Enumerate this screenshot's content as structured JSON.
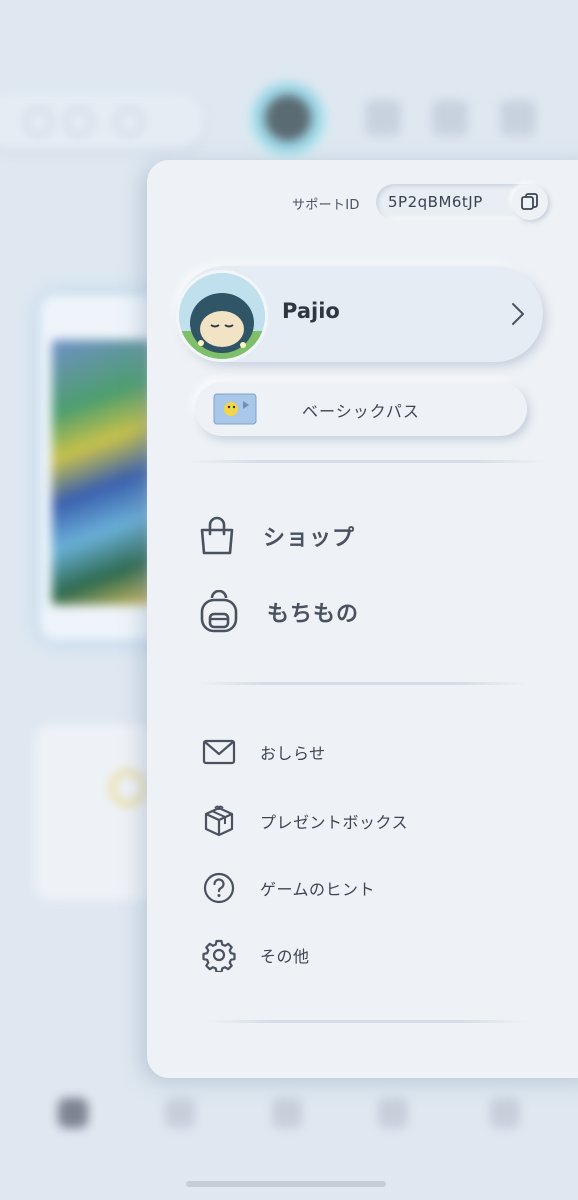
{
  "panel": {
    "support": {
      "label": "サポートID",
      "id": "5P2qBM6tJP"
    },
    "profile": {
      "name": "Pajio"
    },
    "pass": {
      "label": "ベーシックパス"
    },
    "main_menu": [
      {
        "label": "ショップ",
        "icon": "shopping-bag-icon"
      },
      {
        "label": "もちもの",
        "icon": "backpack-icon"
      }
    ],
    "sub_menu": [
      {
        "label": "おしらせ",
        "icon": "mail-icon"
      },
      {
        "label": "プレゼントボックス",
        "icon": "gift-icon"
      },
      {
        "label": "ゲームのヒント",
        "icon": "question-circle-icon"
      },
      {
        "label": "その他",
        "icon": "gear-icon"
      }
    ]
  },
  "colors": {
    "panel_bg": "#eef2f6",
    "page_bg": "#dfe8f1",
    "icon_stroke": "#4a5260"
  }
}
